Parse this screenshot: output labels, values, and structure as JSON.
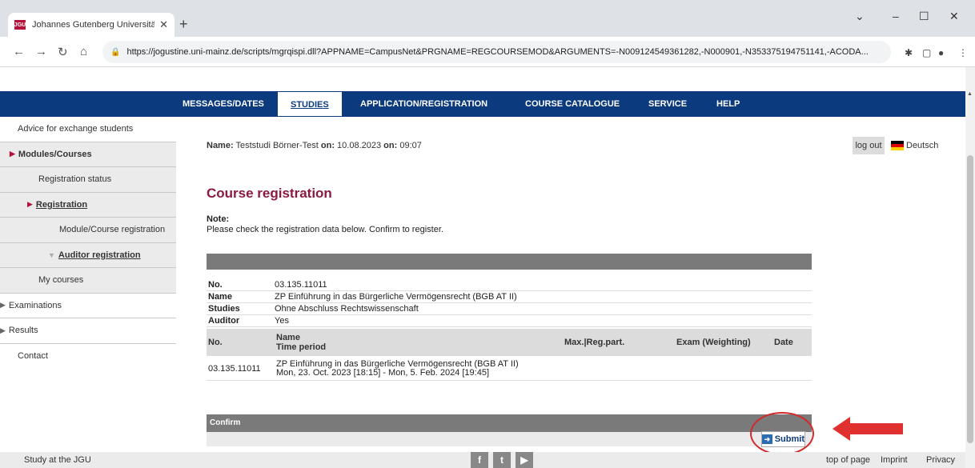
{
  "browser": {
    "tab_title": "Johannes Gutenberg Universität",
    "favicon_text": "JGU",
    "url": "https://jogustine.uni-mainz.de/scripts/mgrqispi.dll?APPNAME=CampusNet&PRGNAME=REGCOURSEMOD&ARGUMENTS=-N009124549361282,-N000901,-N353375194751141,-ACODA..."
  },
  "topnav": {
    "items": [
      "MESSAGES/DATES",
      "STUDIES",
      "APPLICATION/REGISTRATION",
      "COURSE CATALOGUE",
      "SERVICE",
      "HELP"
    ],
    "active": "STUDIES"
  },
  "sidebar": {
    "items": [
      {
        "label": "Advice for exchange students"
      },
      {
        "label": "Modules/Courses"
      },
      {
        "label": "Registration status"
      },
      {
        "label": "Registration"
      },
      {
        "label": "Module/Course registration"
      },
      {
        "label": "Auditor registration"
      },
      {
        "label": "My courses"
      },
      {
        "label": "Examinations"
      },
      {
        "label": "Results"
      },
      {
        "label": "Contact"
      }
    ]
  },
  "user": {
    "name_label": "Name:",
    "name": "Teststudi Börner-Test",
    "on_label1": "on:",
    "date": "10.08.2023",
    "on_label2": "on:",
    "time": "09:07",
    "logout": "log out",
    "language": "Deutsch"
  },
  "main": {
    "heading": "Course registration",
    "note_label": "Note:",
    "note_text": "Please check the registration data below. Confirm to register.",
    "details": [
      {
        "key": "No.",
        "value": "03.135.11011"
      },
      {
        "key": "Name",
        "value": "ZP Einführung in das Bürgerliche Vermögensrecht (BGB AT II)"
      },
      {
        "key": "Studies",
        "value": "Ohne Abschluss Rechtswissenschaft"
      },
      {
        "key": "Auditor",
        "value": "Yes"
      }
    ],
    "course_table": {
      "col_no": "No.",
      "col_name": "Name",
      "col_time": "Time period",
      "col_max": "Max.|Reg.part.",
      "col_exam": "Exam (Weighting)",
      "col_date": "Date",
      "row_no": "03.135.11011",
      "row_name": "ZP Einführung in das Bürgerliche Vermögensrecht (BGB AT II)",
      "row_time": "Mon, 23. Oct. 2023 [18:15] - Mon, 5. Feb. 2024 [19:45]"
    },
    "confirm_label": "Confirm",
    "submit_label": "Submit"
  },
  "footer": {
    "left": "Study at the JGU",
    "top_of_page": "top of page",
    "imprint": "Imprint",
    "privacy": "Privacy"
  },
  "colors": {
    "nav": "#0b3a7e",
    "heading": "#8b1a3e",
    "accent_red": "#b3123b"
  }
}
